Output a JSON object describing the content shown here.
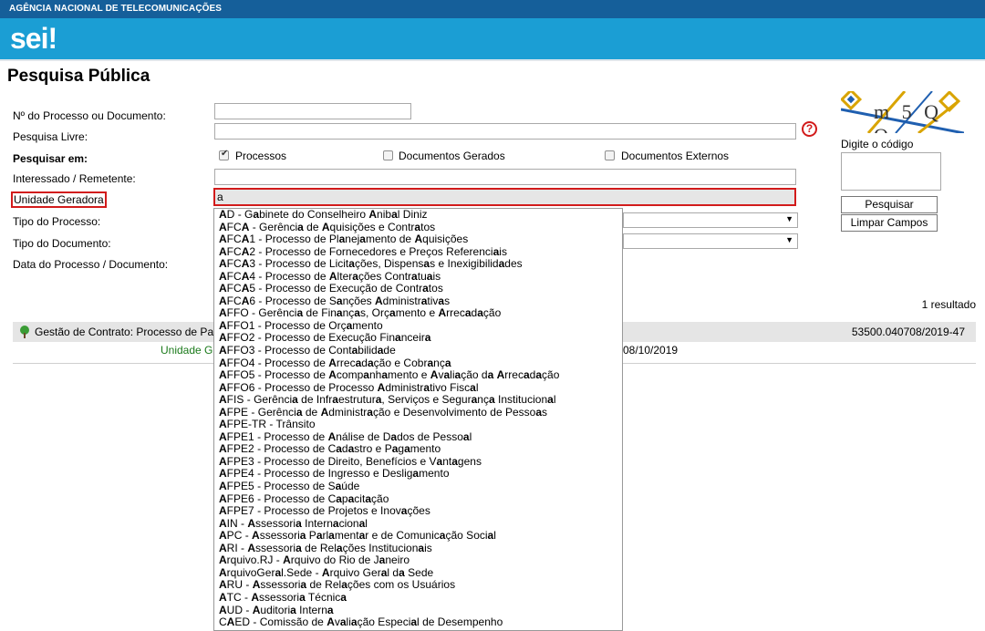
{
  "header": {
    "agency": "AGÊNCIA NACIONAL DE TELECOMUNICAÇÕES",
    "logo": "sei!"
  },
  "page": {
    "title": "Pesquisa Pública"
  },
  "form": {
    "labels": {
      "processo_doc": "Nº do Processo ou Documento:",
      "pesquisa_livre": "Pesquisa Livre:",
      "pesquisar_em": "Pesquisar em:",
      "interessado": "Interessado / Remetente:",
      "unidade": "Unidade Geradora",
      "tipo_processo": "Tipo do Processo:",
      "tipo_documento": "Tipo do Documento:",
      "data": "Data do Processo / Documento:"
    },
    "checkboxes": [
      {
        "label": "Processos",
        "checked": true
      },
      {
        "label": "Documentos Gerados",
        "checked": false
      },
      {
        "label": "Documentos Externos",
        "checked": false
      }
    ],
    "unidade_value": "a",
    "help_icon": "question-circle-icon"
  },
  "captcha": {
    "text": "m 5 Q Q",
    "label": "Digite o código"
  },
  "buttons": {
    "pesquisar": "Pesquisar",
    "limpar": "Limpar Campos"
  },
  "results": {
    "count": "1 resultado",
    "title": "Gestão de Contrato: Processo de Pag",
    "number": "53500.040708/2019-47",
    "unit": "Unidade G",
    "date": "08/10/2019"
  },
  "dropdown_options": [
    "AD - Gabinete do Conselheiro Anibal Diniz",
    "AFCA - Gerência de Aquisições e Contratos",
    "AFCA1 - Processo de Planejamento de Aquisições",
    "AFCA2 - Processo de Fornecedores e Preços Referenciais",
    "AFCA3 - Processo de Licitações, Dispensas e Inexigibilidades",
    "AFCA4 - Processo de Alterações Contratuais",
    "AFCA5 - Processo de Execução de Contratos",
    "AFCA6 - Processo de Sanções Administrativas",
    "AFFO - Gerência de Finanças, Orçamento e Arrecadação",
    "AFFO1 - Processo de Orçamento",
    "AFFO2 - Processo de Execução Financeira",
    "AFFO3 - Processo de Contabilidade",
    "AFFO4 - Processo de Arrecadação e Cobrança",
    "AFFO5 - Processo de Acompanhamento e Avaliação da Arrecadação",
    "AFFO6 - Processo de Processo Administrativo Fiscal",
    "AFIS - Gerência de Infraestrutura, Serviços e Segurança Institucional",
    "AFPE - Gerência de Administração e Desenvolvimento de Pessoas",
    "AFPE-TR - Trânsito",
    "AFPE1 - Processo de Análise de Dados de Pessoal",
    "AFPE2 - Processo de Cadastro e Pagamento",
    "AFPE3 - Processo de Direito, Benefícios e Vantagens",
    "AFPE4 - Processo de Ingresso e Desligamento",
    "AFPE5 - Processo de Saúde",
    "AFPE6 - Processo de Capacitação",
    "AFPE7 - Processo de Projetos e Inovações",
    "AIN - Assessoria Internacional",
    "APC - Assessoria Parlamentar e de Comunicação Social",
    "ARI - Assessoria de Relações Institucionais",
    "Arquivo.RJ - Arquivo do Rio de Janeiro",
    "ArquivoGeral.Sede - Arquivo Geral da Sede",
    "ARU - Assessoria de Relações com os Usuários",
    "ATC - Assessoria Técnica",
    "AUD - Auditoria Interna",
    "CAED - Comissão de Avaliação Especial de Desempenho"
  ]
}
